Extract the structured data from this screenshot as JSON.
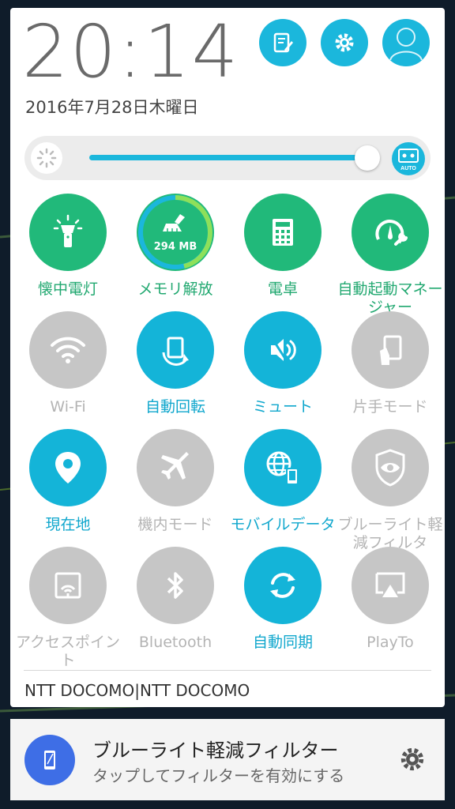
{
  "status": {
    "time": "20:14",
    "date": "2016年7月28日木曜日"
  },
  "header_buttons": [
    {
      "icon": "edit-icon"
    },
    {
      "icon": "gear-icon"
    },
    {
      "icon": "avatar-icon"
    }
  ],
  "brightness": {
    "level_percent": 88,
    "auto_label": "AUTO"
  },
  "tiles": [
    {
      "label": "懐中電灯",
      "icon": "flashlight-icon",
      "state": "on-green"
    },
    {
      "label": "メモリ解放",
      "icon": "broom-icon",
      "state": "on-green",
      "badge": "294 MB"
    },
    {
      "label": "電卓",
      "icon": "calculator-icon",
      "state": "on-green"
    },
    {
      "label": "自動起動マネージャー",
      "icon": "gauge-wrench-icon",
      "state": "on-green"
    },
    {
      "label": "Wi-Fi",
      "icon": "wifi-icon",
      "state": "off"
    },
    {
      "label": "自動回転",
      "icon": "rotate-icon",
      "state": "on-blue"
    },
    {
      "label": "ミュート",
      "icon": "speaker-mute-icon",
      "state": "on-blue"
    },
    {
      "label": "片手モード",
      "icon": "one-hand-icon",
      "state": "off"
    },
    {
      "label": "現在地",
      "icon": "location-pin-icon",
      "state": "on-blue"
    },
    {
      "label": "機内モード",
      "icon": "airplane-icon",
      "state": "off"
    },
    {
      "label": "モバイルデータ",
      "icon": "globe-phone-icon",
      "state": "on-blue"
    },
    {
      "label": "ブルーライト軽減フィルタ",
      "icon": "eye-shield-icon",
      "state": "off"
    },
    {
      "label": "アクセスポイント",
      "icon": "hotspot-icon",
      "state": "off"
    },
    {
      "label": "Bluetooth",
      "icon": "bluetooth-icon",
      "state": "off"
    },
    {
      "label": "自動同期",
      "icon": "sync-icon",
      "state": "on-blue"
    },
    {
      "label": "PlayTo",
      "icon": "cast-icon",
      "state": "off"
    }
  ],
  "carrier": "NTT DOCOMO|NTT DOCOMO",
  "notification": {
    "title": "ブルーライト軽減フィルター",
    "text": "タップしてフィルターを有効にする"
  },
  "colors": {
    "accent_blue": "#14b4d8",
    "accent_green": "#21b97a",
    "inactive_gray": "#c6c6c6",
    "notification_icon_bg": "#3e6ee6"
  }
}
